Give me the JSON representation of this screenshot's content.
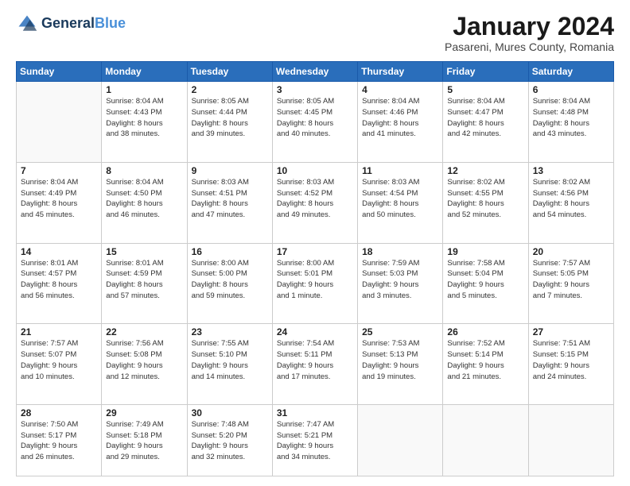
{
  "logo": {
    "line1": "General",
    "line2": "Blue"
  },
  "header": {
    "month": "January 2024",
    "location": "Pasareni, Mures County, Romania"
  },
  "weekdays": [
    "Sunday",
    "Monday",
    "Tuesday",
    "Wednesday",
    "Thursday",
    "Friday",
    "Saturday"
  ],
  "weeks": [
    [
      {
        "day": "",
        "info": ""
      },
      {
        "day": "1",
        "info": "Sunrise: 8:04 AM\nSunset: 4:43 PM\nDaylight: 8 hours\nand 38 minutes."
      },
      {
        "day": "2",
        "info": "Sunrise: 8:05 AM\nSunset: 4:44 PM\nDaylight: 8 hours\nand 39 minutes."
      },
      {
        "day": "3",
        "info": "Sunrise: 8:05 AM\nSunset: 4:45 PM\nDaylight: 8 hours\nand 40 minutes."
      },
      {
        "day": "4",
        "info": "Sunrise: 8:04 AM\nSunset: 4:46 PM\nDaylight: 8 hours\nand 41 minutes."
      },
      {
        "day": "5",
        "info": "Sunrise: 8:04 AM\nSunset: 4:47 PM\nDaylight: 8 hours\nand 42 minutes."
      },
      {
        "day": "6",
        "info": "Sunrise: 8:04 AM\nSunset: 4:48 PM\nDaylight: 8 hours\nand 43 minutes."
      }
    ],
    [
      {
        "day": "7",
        "info": "Sunrise: 8:04 AM\nSunset: 4:49 PM\nDaylight: 8 hours\nand 45 minutes."
      },
      {
        "day": "8",
        "info": "Sunrise: 8:04 AM\nSunset: 4:50 PM\nDaylight: 8 hours\nand 46 minutes."
      },
      {
        "day": "9",
        "info": "Sunrise: 8:03 AM\nSunset: 4:51 PM\nDaylight: 8 hours\nand 47 minutes."
      },
      {
        "day": "10",
        "info": "Sunrise: 8:03 AM\nSunset: 4:52 PM\nDaylight: 8 hours\nand 49 minutes."
      },
      {
        "day": "11",
        "info": "Sunrise: 8:03 AM\nSunset: 4:54 PM\nDaylight: 8 hours\nand 50 minutes."
      },
      {
        "day": "12",
        "info": "Sunrise: 8:02 AM\nSunset: 4:55 PM\nDaylight: 8 hours\nand 52 minutes."
      },
      {
        "day": "13",
        "info": "Sunrise: 8:02 AM\nSunset: 4:56 PM\nDaylight: 8 hours\nand 54 minutes."
      }
    ],
    [
      {
        "day": "14",
        "info": "Sunrise: 8:01 AM\nSunset: 4:57 PM\nDaylight: 8 hours\nand 56 minutes."
      },
      {
        "day": "15",
        "info": "Sunrise: 8:01 AM\nSunset: 4:59 PM\nDaylight: 8 hours\nand 57 minutes."
      },
      {
        "day": "16",
        "info": "Sunrise: 8:00 AM\nSunset: 5:00 PM\nDaylight: 8 hours\nand 59 minutes."
      },
      {
        "day": "17",
        "info": "Sunrise: 8:00 AM\nSunset: 5:01 PM\nDaylight: 9 hours\nand 1 minute."
      },
      {
        "day": "18",
        "info": "Sunrise: 7:59 AM\nSunset: 5:03 PM\nDaylight: 9 hours\nand 3 minutes."
      },
      {
        "day": "19",
        "info": "Sunrise: 7:58 AM\nSunset: 5:04 PM\nDaylight: 9 hours\nand 5 minutes."
      },
      {
        "day": "20",
        "info": "Sunrise: 7:57 AM\nSunset: 5:05 PM\nDaylight: 9 hours\nand 7 minutes."
      }
    ],
    [
      {
        "day": "21",
        "info": "Sunrise: 7:57 AM\nSunset: 5:07 PM\nDaylight: 9 hours\nand 10 minutes."
      },
      {
        "day": "22",
        "info": "Sunrise: 7:56 AM\nSunset: 5:08 PM\nDaylight: 9 hours\nand 12 minutes."
      },
      {
        "day": "23",
        "info": "Sunrise: 7:55 AM\nSunset: 5:10 PM\nDaylight: 9 hours\nand 14 minutes."
      },
      {
        "day": "24",
        "info": "Sunrise: 7:54 AM\nSunset: 5:11 PM\nDaylight: 9 hours\nand 17 minutes."
      },
      {
        "day": "25",
        "info": "Sunrise: 7:53 AM\nSunset: 5:13 PM\nDaylight: 9 hours\nand 19 minutes."
      },
      {
        "day": "26",
        "info": "Sunrise: 7:52 AM\nSunset: 5:14 PM\nDaylight: 9 hours\nand 21 minutes."
      },
      {
        "day": "27",
        "info": "Sunrise: 7:51 AM\nSunset: 5:15 PM\nDaylight: 9 hours\nand 24 minutes."
      }
    ],
    [
      {
        "day": "28",
        "info": "Sunrise: 7:50 AM\nSunset: 5:17 PM\nDaylight: 9 hours\nand 26 minutes."
      },
      {
        "day": "29",
        "info": "Sunrise: 7:49 AM\nSunset: 5:18 PM\nDaylight: 9 hours\nand 29 minutes."
      },
      {
        "day": "30",
        "info": "Sunrise: 7:48 AM\nSunset: 5:20 PM\nDaylight: 9 hours\nand 32 minutes."
      },
      {
        "day": "31",
        "info": "Sunrise: 7:47 AM\nSunset: 5:21 PM\nDaylight: 9 hours\nand 34 minutes."
      },
      {
        "day": "",
        "info": ""
      },
      {
        "day": "",
        "info": ""
      },
      {
        "day": "",
        "info": ""
      }
    ]
  ]
}
